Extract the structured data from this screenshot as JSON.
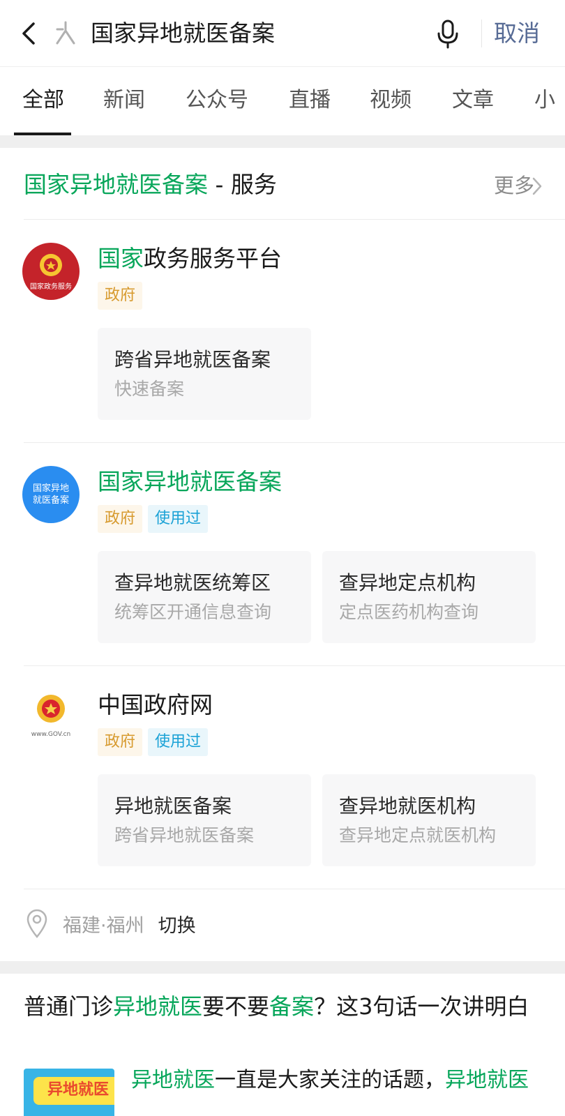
{
  "search": {
    "query": "国家异地就医备案",
    "cancel_label": "取消"
  },
  "tabs": [
    {
      "label": "全部",
      "active": true
    },
    {
      "label": "新闻"
    },
    {
      "label": "公众号"
    },
    {
      "label": "直播"
    },
    {
      "label": "视频"
    },
    {
      "label": "文章"
    },
    {
      "label": "小"
    }
  ],
  "service_section": {
    "title_highlight": "国家异地就医备案",
    "title_suffix": " - 服务",
    "more_label": "更多",
    "items": [
      {
        "name_highlight": "国家",
        "name_rest": "政务服务平台",
        "logo_text": "国家政务服务",
        "tags": [
          "政府"
        ],
        "cards": [
          {
            "title": "跨省异地就医备案",
            "subtitle": "快速备案"
          }
        ]
      },
      {
        "name_highlight": "国家异地就医备案",
        "name_rest": "",
        "logo_text_line1": "国家异地",
        "logo_text_line2": "就医备案",
        "tags": [
          "政府",
          "使用过"
        ],
        "cards": [
          {
            "title": "查异地就医统筹区",
            "subtitle": "统筹区开通信息查询"
          },
          {
            "title": "查异地定点机构",
            "subtitle": "定点医药机构查询"
          }
        ]
      },
      {
        "name_highlight": "",
        "name_rest": "中国政府网",
        "logo_text": "www.GOV.cn",
        "tags": [
          "政府",
          "使用过"
        ],
        "cards": [
          {
            "title": "异地就医备案",
            "subtitle": "跨省异地就医备案"
          },
          {
            "title": "查异地就医机构",
            "subtitle": "查异地定点就医机构"
          }
        ]
      }
    ],
    "location": "福建·福州",
    "switch_label": "切换"
  },
  "article": {
    "title_parts": [
      {
        "text": "普通门诊",
        "hl": false
      },
      {
        "text": "异地就医",
        "hl": true
      },
      {
        "text": "要不要",
        "hl": false
      },
      {
        "text": "备案",
        "hl": true
      },
      {
        "text": "？这3句话一次讲明白",
        "hl": false
      }
    ],
    "snippet_parts": [
      {
        "text": "异地就医",
        "hl": true
      },
      {
        "text": "一直是大家关注的话题，",
        "hl": false
      },
      {
        "text": "异地就医",
        "hl": true
      }
    ],
    "thumb_text": "异地就医"
  },
  "colors": {
    "highlight": "#07a65a",
    "cancel": "#576b95",
    "tag_gov": "#d79a2e",
    "tag_used": "#1ba2d6"
  }
}
